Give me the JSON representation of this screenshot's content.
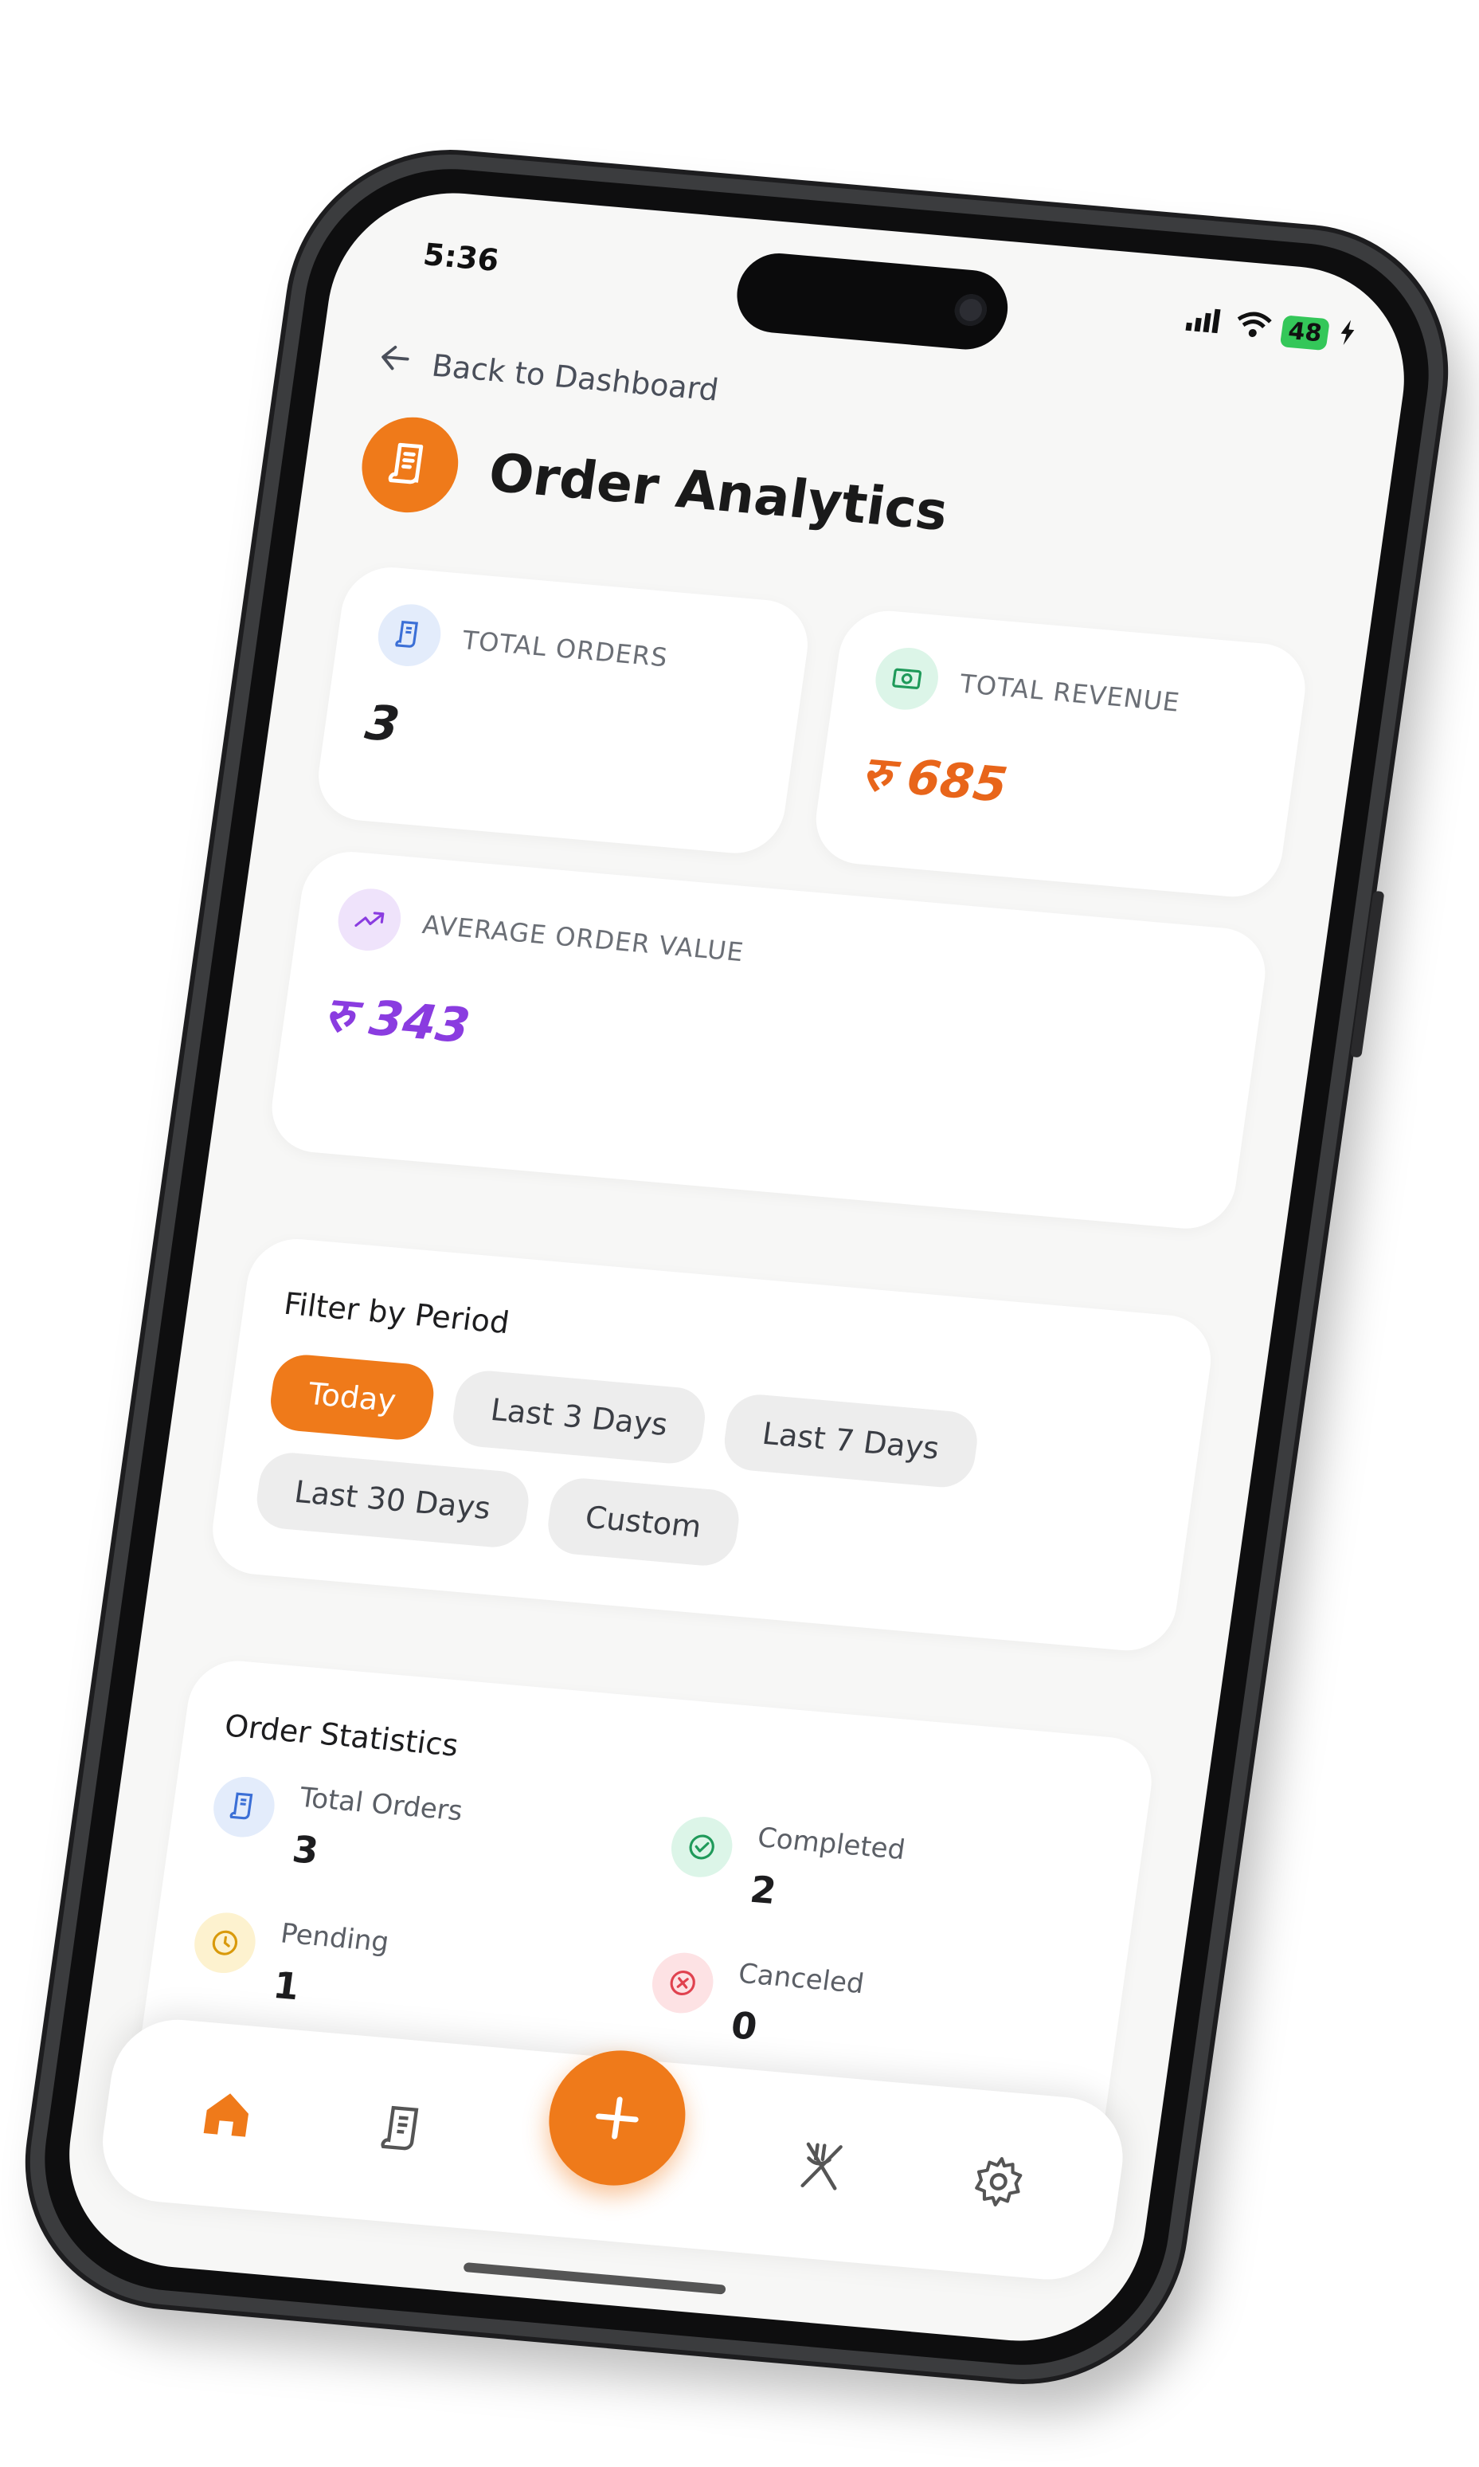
{
  "status_bar": {
    "time": "5:36",
    "battery": "48"
  },
  "nav": {
    "back_label": "Back to Dashboard"
  },
  "header": {
    "title": "Order Analytics"
  },
  "summary": {
    "total_orders": {
      "label": "TOTAL ORDERS",
      "value": "3"
    },
    "total_revenue": {
      "label": "TOTAL REVENUE",
      "value": "रु 685"
    },
    "average_order_value": {
      "label": "AVERAGE ORDER VALUE",
      "value": "रु 343"
    }
  },
  "filter": {
    "title": "Filter by Period",
    "options": [
      "Today",
      "Last 3 Days",
      "Last 7 Days",
      "Last 30 Days",
      "Custom"
    ],
    "selected": "Today"
  },
  "statistics": {
    "title": "Order Statistics",
    "items": [
      {
        "label": "Total Orders",
        "value": "3"
      },
      {
        "label": "Completed",
        "value": "2"
      },
      {
        "label": "Pending",
        "value": "1"
      },
      {
        "label": "Canceled",
        "value": "0"
      }
    ]
  },
  "colors": {
    "accent": "#ef7a1a",
    "revenue": "#e8651a",
    "average": "#8a3ce0",
    "background": "#f7f7f6"
  },
  "icons": {
    "back": "arrow-left-icon",
    "header": "receipt-icon",
    "orders": "receipt-icon",
    "revenue": "cash-icon",
    "average": "trend-up-icon",
    "completed": "check-circle-icon",
    "pending": "clock-icon",
    "canceled": "x-circle-icon",
    "nav_home": "home-icon",
    "nav_orders": "receipt-icon",
    "nav_add": "plus-icon",
    "nav_menu": "utensils-icon",
    "nav_settings": "gear-icon"
  }
}
